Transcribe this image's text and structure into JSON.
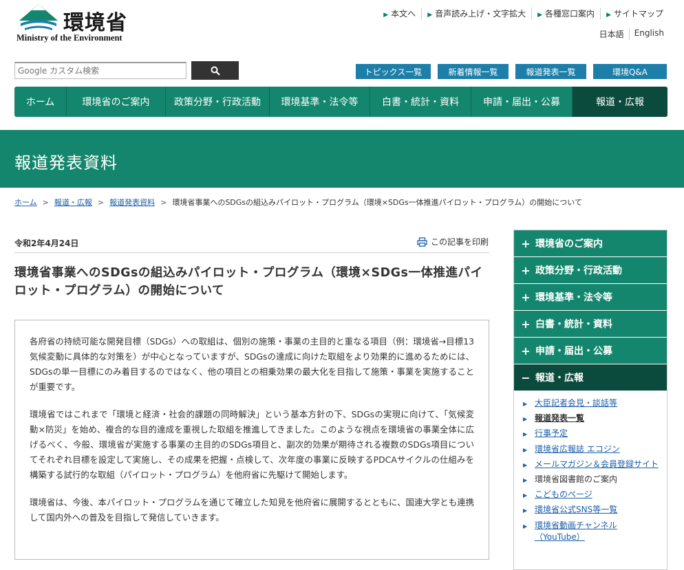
{
  "header": {
    "logo_jp": "環境省",
    "logo_en": "Ministry of the Environment",
    "util_links": [
      "本文へ",
      "音声読み上げ・文字拡大",
      "各種窓口案内",
      "サイトマップ"
    ],
    "lang": [
      "日本語",
      "English"
    ],
    "search_placeholder": "Google カスタム検索",
    "topics": [
      "トピックス一覧",
      "新着情報一覧",
      "報道発表一覧",
      "環境Q&A"
    ]
  },
  "gnav": [
    "ホーム",
    "環境省のご案内",
    "政策分野・行政活動",
    "環境基準・法令等",
    "白書・統計・資料",
    "申請・届出・公募",
    "報道・広報"
  ],
  "page_title": "報道発表資料",
  "breadcrumb": {
    "links": [
      "ホーム",
      "報道・広報",
      "報道発表資料"
    ],
    "current": "環境省事業へのSDGsの組込みパイロット・プログラム（環境×SDGs一体推進パイロット・プログラム）の開始について"
  },
  "article": {
    "date": "令和2年4月24日",
    "print_label": "この記事を印刷",
    "title": "環境省事業へのSDGsの組込みパイロット・プログラム（環境×SDGs一体推進パイロット・プログラム）の開始について",
    "paragraphs": [
      "各府省の持続可能な開発目標（SDGs）への取組は、個別の施策・事業の主目的と重なる項目（例：環境省→目標13 気候変動に具体的な対策を）が中心となっていますが、SDGsの達成に向けた取組をより効果的に進めるためには、SDGsの単一目標にのみ着目するのではなく、他の項目との相乗効果の最大化を目指して施策・事業を実施することが重要です。",
      "環境省ではこれまで「環境と経済・社会的課題の同時解決」という基本方針の下、SDGsの実現に向けて、「気候変動×防災」を始め、複合的な目的達成を重視した取組を推進してきました。このような視点を環境省の事業全体に広げるべく、今般、環境省が実施する事業の主目的のSDGs項目と、副次的効果が期待される複数のSDGs項目についてそれぞれ目標を設定して実施し、その成果を把握・点検して、次年度の事業に反映するPDCAサイクルの仕組みを構築する試行的な取組（パイロット・プログラム）を他府省に先駆けて開始します。",
      "環境省は、今後、本パイロット・プログラムを通じて確立した知見を他府省に展開するとともに、国連大学とも連携して国内外への普及を目指して発信していきます。"
    ]
  },
  "sidenav": {
    "items": [
      "環境省のご案内",
      "政策分野・行政活動",
      "環境基準・法令等",
      "白書・統計・資料",
      "申請・届出・公募",
      "報道・広報"
    ],
    "plus": "+",
    "minus": "−",
    "sub": [
      "大臣記者会見・談話等",
      "報道発表一覧",
      "行事予定",
      "環境省広報誌 エコジン",
      "メールマガジン＆会員登録サイト",
      "環境省図書館のご案内",
      "こどものページ",
      "環境省公式SNS等一覧",
      "環境省動画チャンネル（YouTube）"
    ]
  },
  "colors": {
    "brand_green": "#14866e",
    "dark_green": "#0b4b3d",
    "topic_blue": "#1d7fa9",
    "link_blue": "#1d5fa9"
  }
}
